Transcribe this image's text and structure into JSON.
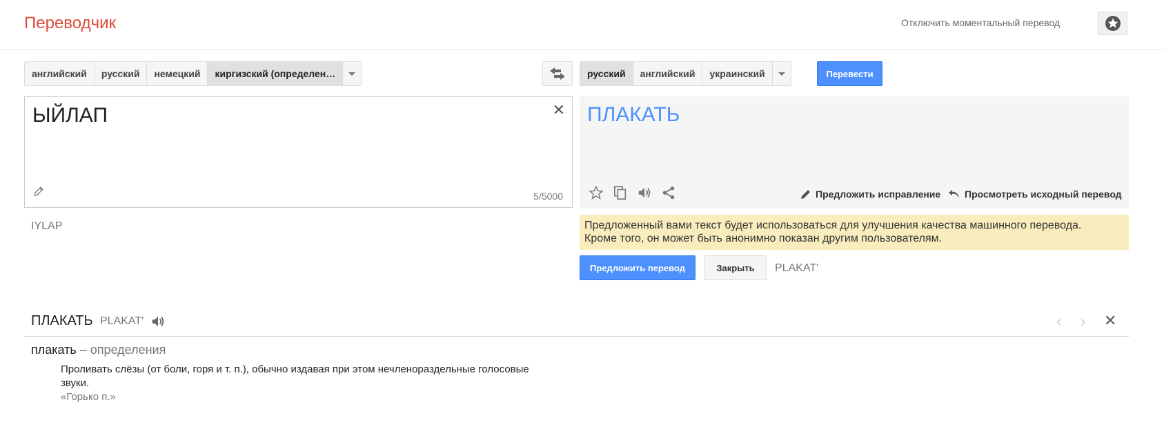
{
  "header": {
    "title": "Переводчик",
    "instant_toggle": "Отключить моментальный перевод"
  },
  "source_langs": [
    "английский",
    "русский",
    "немецкий",
    "киргизский (определен…"
  ],
  "target_langs": [
    "русский",
    "английский",
    "украинский"
  ],
  "translate_label": "Перевести",
  "source": {
    "text": "ЫЙЛАП",
    "char_count": "5/5000",
    "transliteration": "IYLAP"
  },
  "result": {
    "text": "ПЛАКАТЬ",
    "suggest_edit": "Предложить исправление",
    "view_original": "Просмотреть исходный перевод"
  },
  "notice": {
    "line1": "Предложенный вами текст будет использоваться для улучшения качества машинного перевода.",
    "line2": "Кроме того, он может быть анонимно показан другим пользователям."
  },
  "suggest_button": "Предложить перевод",
  "close_button": "Закрыть",
  "result_transliteration": "PLAKAT'",
  "dictionary": {
    "word": "ПЛАКАТЬ",
    "transliteration": "PLAKAT'",
    "def_word": "плакать",
    "def_sep": " – ",
    "def_label": "определения",
    "definition": "Проливать слёзы (от боли, горя и т. п.), обычно издавая при этом нечленораздельные голосовые звуки.",
    "example": "«Горько п.»"
  },
  "colors": {
    "brand": "#dd4b39",
    "accent_blue": "#4d90fe",
    "notice_bg": "#f9edbe"
  }
}
